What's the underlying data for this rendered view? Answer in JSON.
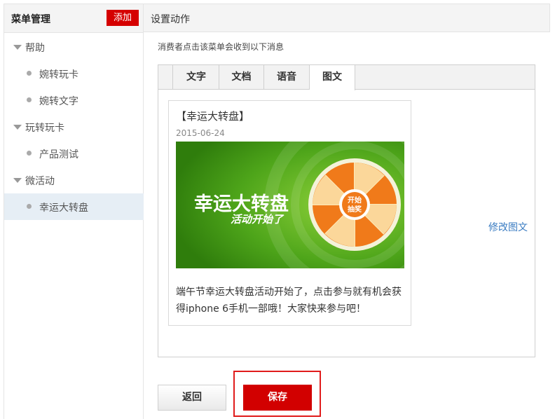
{
  "sidebar": {
    "title": "菜单管理",
    "add_label": "添加",
    "groups": [
      {
        "label": "帮助",
        "items": [
          {
            "label": "婉转玩卡"
          },
          {
            "label": "婉转文字"
          }
        ]
      },
      {
        "label": "玩转玩卡",
        "items": [
          {
            "label": "产品测试"
          }
        ]
      },
      {
        "label": "微活动",
        "items": [
          {
            "label": "幸运大转盘",
            "active": true
          }
        ]
      }
    ]
  },
  "main": {
    "title": "设置动作",
    "hint": "消费者点击该菜单会收到以下消息",
    "tabs": [
      {
        "label": "文字"
      },
      {
        "label": "文档"
      },
      {
        "label": "语音"
      },
      {
        "label": "图文",
        "active": true
      }
    ],
    "card": {
      "title": "【幸运大转盘】",
      "date": "2015-06-24",
      "image": {
        "headline": "幸运大转盘",
        "subline": "活动开始了",
        "wheel_center_line1": "开始",
        "wheel_center_line2": "抽奖"
      },
      "description": "端午节幸运大转盘活动开始了，点击参与就有机会获得iphone 6手机一部哦！大家快来参与吧！"
    },
    "edit_label": "修改图文",
    "back_label": "返回",
    "save_label": "保存"
  },
  "colors": {
    "accent_red": "#d20000",
    "link_blue": "#3a7cc2",
    "active_item_bg": "#e6eef5",
    "banner_green": "#3f9a12",
    "wheel_orange": "#f07a1a"
  }
}
